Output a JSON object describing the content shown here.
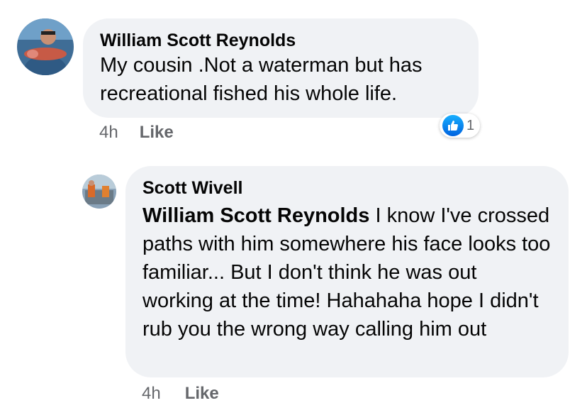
{
  "comments": [
    {
      "author": "William Scott Reynolds",
      "text": "My cousin .Not a waterman but has recreational fished his whole life.",
      "time": "4h",
      "like_label": "Like",
      "reaction_count": "1"
    },
    {
      "author": "Scott Wivell",
      "mention": "William Scott Reynolds",
      "text": "I know I've crossed paths with him somewhere his face looks too familiar... But I don't think he was out working at the time! Hahahaha hope I didn't rub  you the wrong way calling him out",
      "time": "4h",
      "like_label": "Like"
    }
  ],
  "colors": {
    "bubble": "#f0f2f5",
    "like_blue": "#1877f2",
    "meta_gray": "#65676b"
  }
}
